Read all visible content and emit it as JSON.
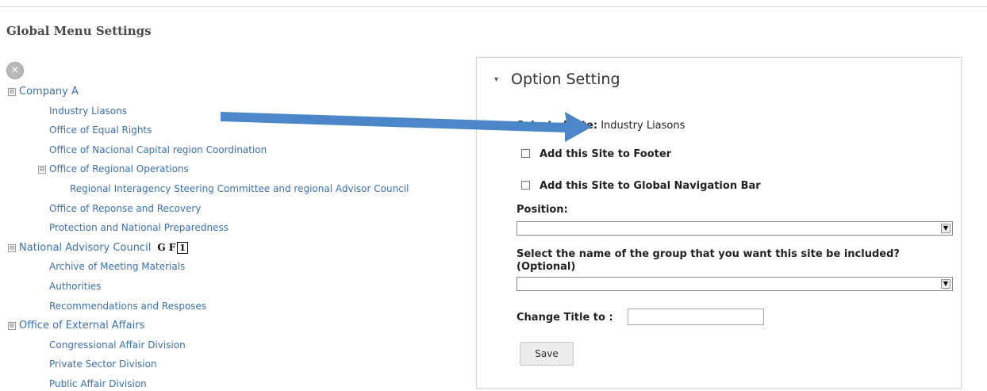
{
  "page": {
    "title": "Global Menu Settings"
  },
  "tree": {
    "close_glyph": "×",
    "items": [
      {
        "label": "Company A",
        "level": 0,
        "expander": "⊟"
      },
      {
        "label": "Industry Liasons",
        "level": 1
      },
      {
        "label": "Office of Equal Rights",
        "level": 1
      },
      {
        "label": "Office of Nacional Capital region Coordination",
        "level": 1
      },
      {
        "label": "Office of Regional Operations",
        "level": 1,
        "expander": "⊟"
      },
      {
        "label": "Regional Interagency Steering Committee and regional Advisor Council",
        "level": 2
      },
      {
        "label": "Office of Reponse and Recovery",
        "level": 1
      },
      {
        "label": "Protection and National Preparedness",
        "level": 1
      },
      {
        "label": "National Advisory Council",
        "level": 0,
        "expander": "⊟",
        "access_keys": "G F",
        "access_key_box": "1"
      },
      {
        "label": "Archive of Meeting Materials",
        "level": 1
      },
      {
        "label": "Authorities",
        "level": 1
      },
      {
        "label": "Recommendations and Resposes",
        "level": 1
      },
      {
        "label": "Office of External Affairs",
        "level": 0,
        "expander": "⊟"
      },
      {
        "label": "Congressional Affair Division",
        "level": 1
      },
      {
        "label": "Private Sector Division",
        "level": 1
      },
      {
        "label": "Public Affair Division",
        "level": 1
      }
    ]
  },
  "option_panel": {
    "title": "Option Setting",
    "caret": "▾",
    "selected_label": "Selected Site:",
    "selected_value": "Industry Liasons",
    "add_footer_label": "Add this Site to Footer",
    "add_nav_label": "Add this Site to Global Navigation Bar",
    "position_label": "Position:",
    "position_value": "",
    "group_label": "Select the name of the group that you want this site be included? (Optional)",
    "group_value": "",
    "change_title_label": "Change Title to :",
    "change_title_value": "",
    "save_label": "Save",
    "select_arrow": "▼"
  },
  "colors": {
    "link": "#3a6fb5",
    "annotation_arrow": "#4a86c8"
  }
}
